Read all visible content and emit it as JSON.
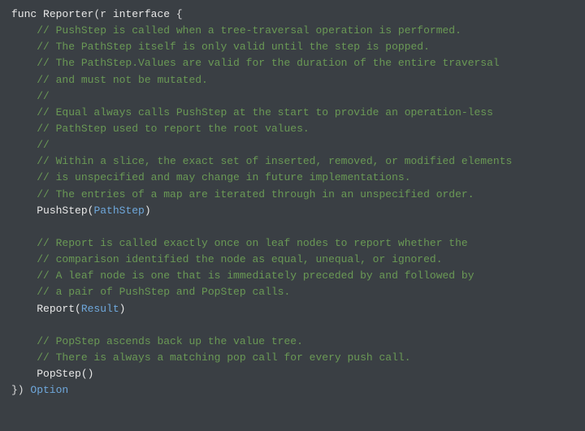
{
  "code": {
    "line1_func": "func ",
    "line1_name": "Reporter",
    "line1_open": "(r ",
    "line1_interface": "interface",
    "line1_brace": " {",
    "indent1": "    ",
    "c1": "// PushStep is called when a tree-traversal operation is performed.",
    "c2": "// The PathStep itself is only valid until the step is popped.",
    "c3": "// The PathStep.Values are valid for the duration of the entire traversal",
    "c4": "// and must not be mutated.",
    "c5": "//",
    "c6": "// Equal always calls PushStep at the start to provide an operation-less",
    "c7": "// PathStep used to report the root values.",
    "c8": "//",
    "c9": "// Within a slice, the exact set of inserted, removed, or modified elements",
    "c10": "// is unspecified and may change in future implementations.",
    "c11": "// The entries of a map are iterated through in an unspecified order.",
    "push_name": "PushStep(",
    "push_type": "PathStep",
    "push_close": ")",
    "c12": "// Report is called exactly once on leaf nodes to report whether the",
    "c13": "// comparison identified the node as equal, unequal, or ignored.",
    "c14": "// A leaf node is one that is immediately preceded by and followed by",
    "c15": "// a pair of PushStep and PopStep calls.",
    "report_name": "Report(",
    "report_type": "Result",
    "report_close": ")",
    "c16": "// PopStep ascends back up the value tree.",
    "c17": "// There is always a matching pop call for every push call.",
    "pop": "PopStep()",
    "close_brace": "}) ",
    "return_type": "Option"
  }
}
